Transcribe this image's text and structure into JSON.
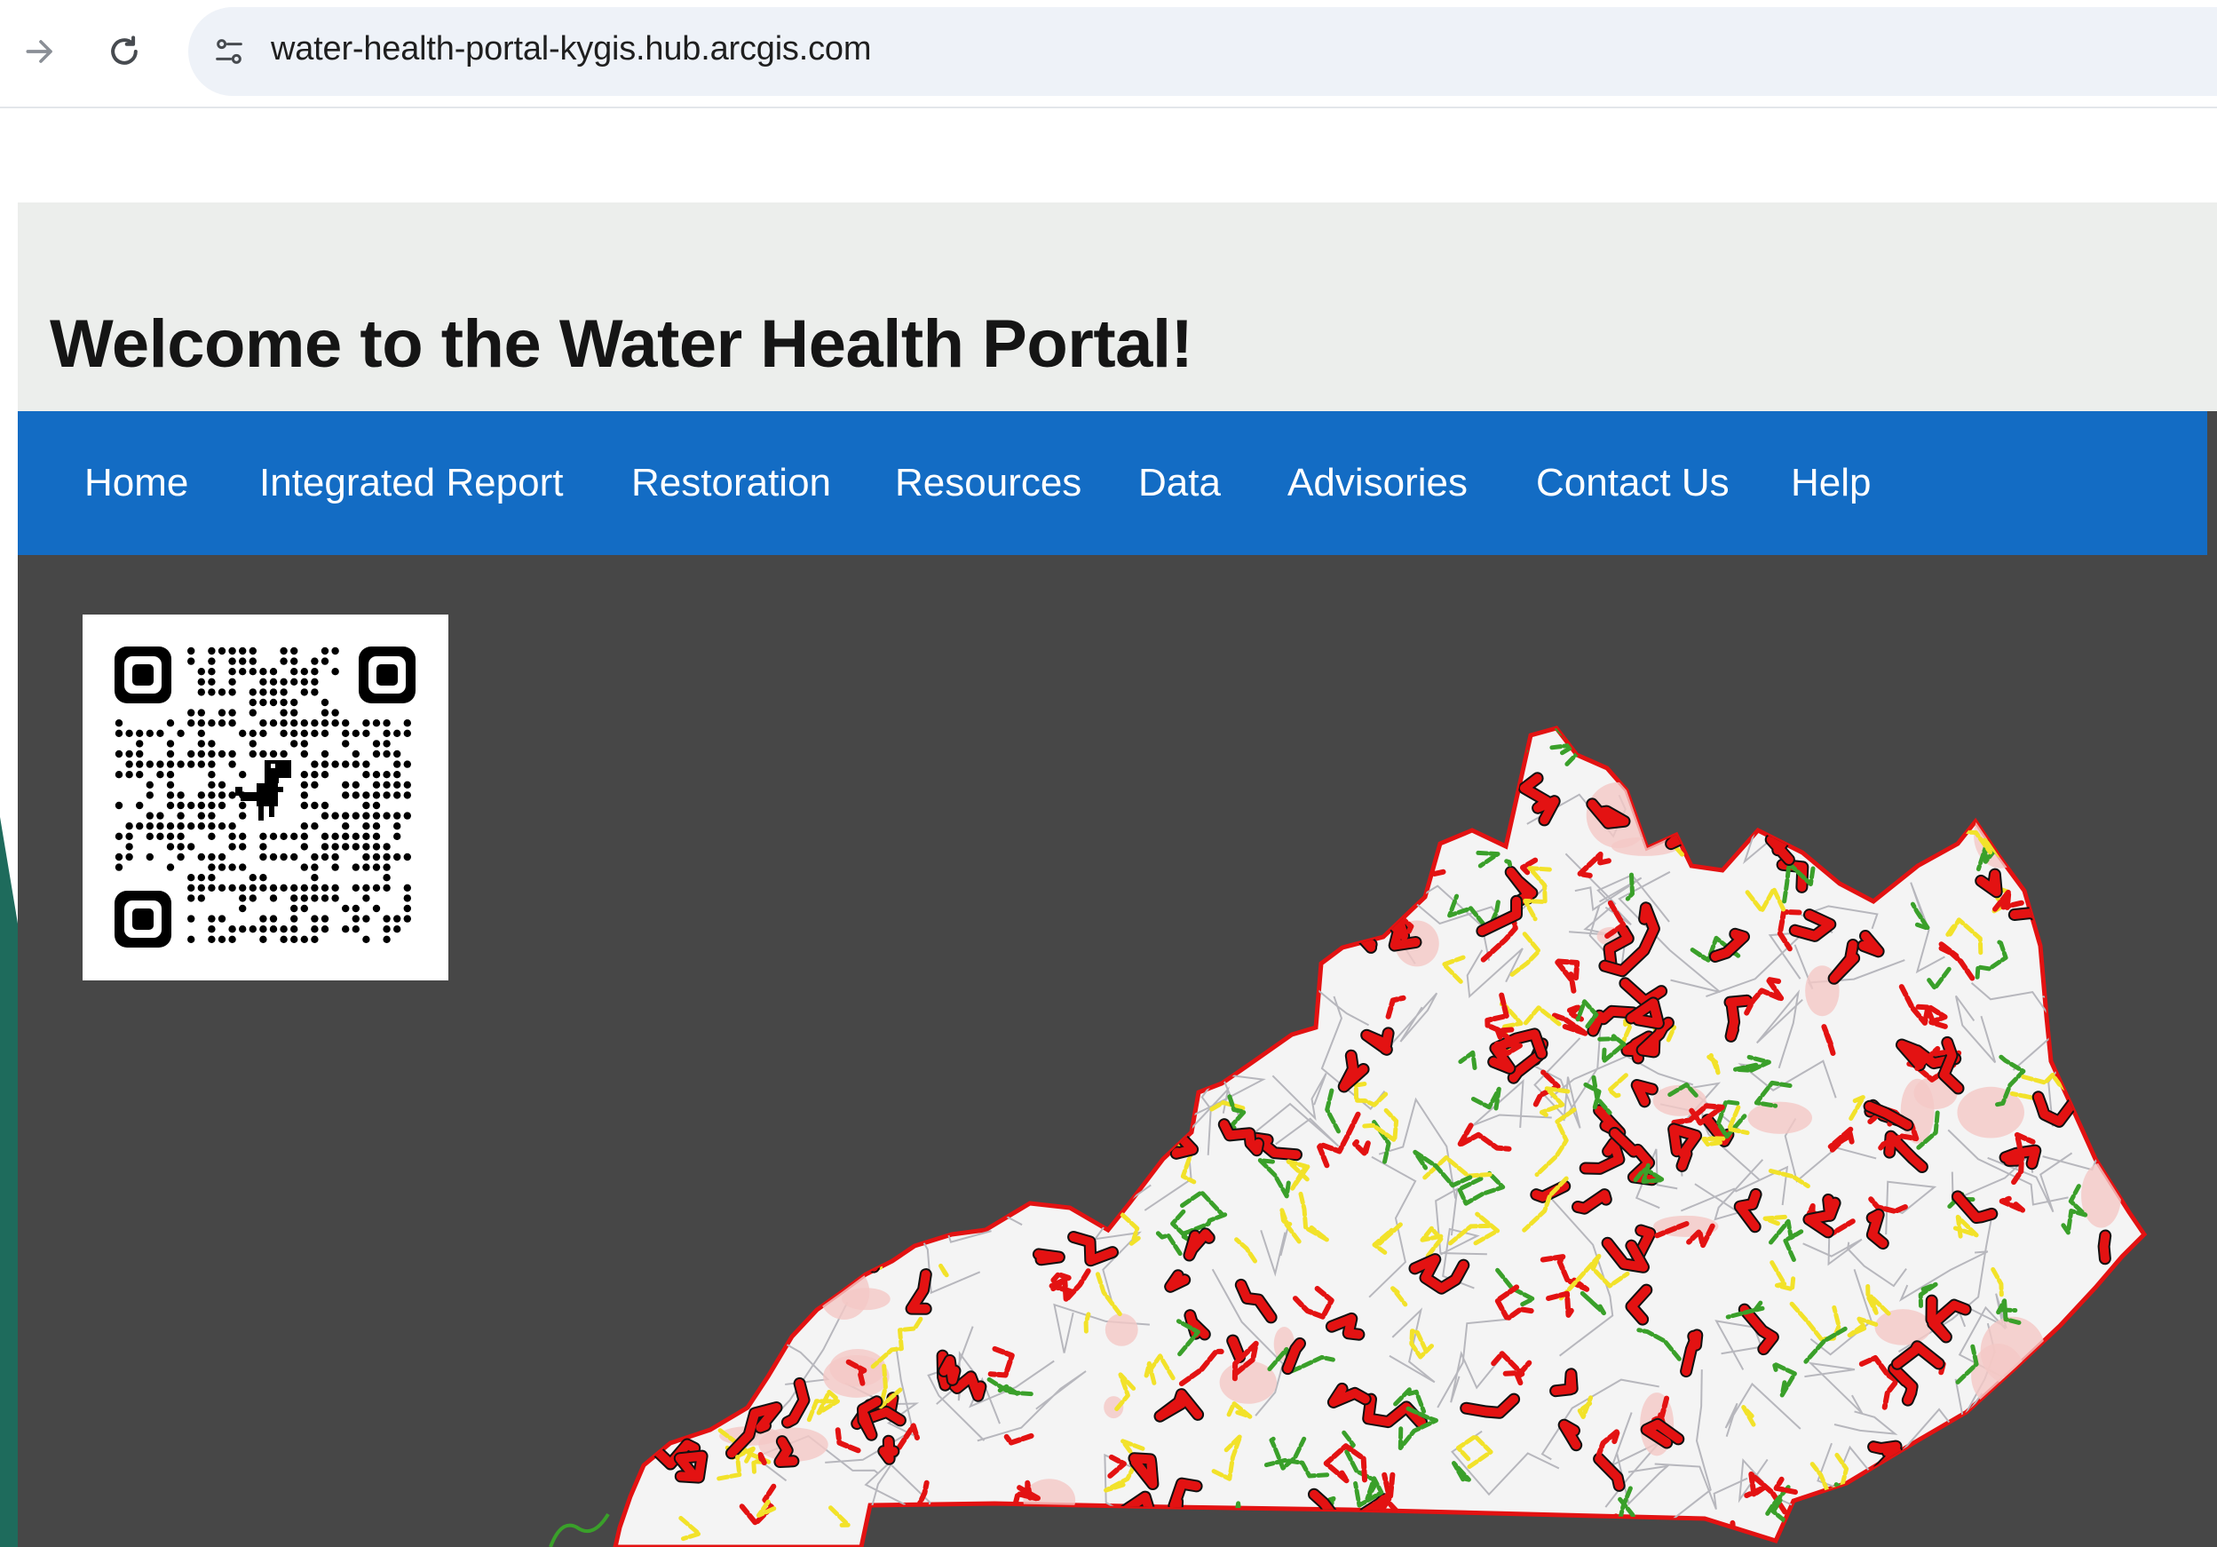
{
  "browser": {
    "url": "water-health-portal-kygis.hub.arcgis.com",
    "icons": [
      "forward-arrow-icon",
      "reload-icon",
      "site-info-icon"
    ]
  },
  "header": {
    "title": "Welcome to the Water Health Portal!"
  },
  "nav": {
    "items": [
      {
        "label": "Home"
      },
      {
        "label": "Integrated Report"
      },
      {
        "label": "Restoration"
      },
      {
        "label": "Resources"
      },
      {
        "label": "Data"
      },
      {
        "label": "Advisories"
      },
      {
        "label": "Contact Us"
      },
      {
        "label": "Help"
      }
    ]
  },
  "colors": {
    "navbar": "#136cc4",
    "hero_bg": "#eceeec",
    "content_bg": "#474747",
    "map_impaired": "#e31212",
    "map_partial": "#f2e22a",
    "map_supporting": "#3aa02a",
    "map_fill": "#f4f4f4",
    "state_border": "#e31212",
    "slide_edge": "#1e6b5c"
  },
  "map": {
    "description_icon": "kentucky-water-map"
  },
  "qr": {
    "icon": "qr-code-icon",
    "center_icon": "dinosaur-icon"
  }
}
